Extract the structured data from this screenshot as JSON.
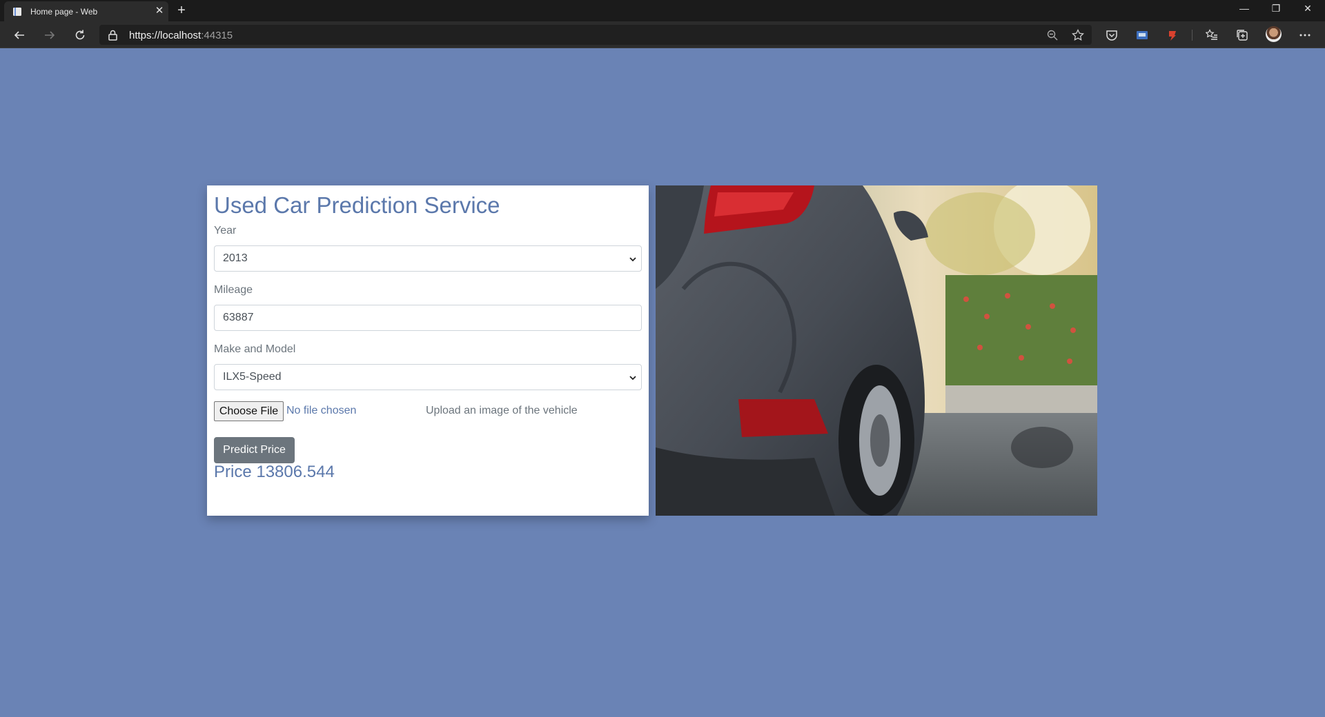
{
  "browser": {
    "tab_title": "Home page - Web",
    "url_main": "https://localhost",
    "url_port": ":44315"
  },
  "page": {
    "title": "Used Car Prediction Service",
    "year": {
      "label": "Year",
      "value": "2013"
    },
    "mileage": {
      "label": "Mileage",
      "value": "63887"
    },
    "make_model": {
      "label": "Make and Model",
      "value": "ILX5-Speed"
    },
    "file": {
      "button_label": "Choose File",
      "status": "No file chosen",
      "hint": "Upload an image of the vehicle"
    },
    "predict_button": "Predict Price",
    "price_text": "Price 13806.544"
  },
  "colors": {
    "page_background": "#6a83b5",
    "accent_text": "#5b78ab",
    "button_gray": "#6c757d"
  },
  "icons": [
    "page-icon",
    "close-icon",
    "plus-icon",
    "back-icon",
    "forward-icon",
    "refresh-icon",
    "lock-icon",
    "zoom-icon",
    "star-icon",
    "pocket-icon",
    "extension-icon",
    "favorites-icon",
    "collections-icon",
    "more-icon",
    "chevron-down-icon"
  ]
}
